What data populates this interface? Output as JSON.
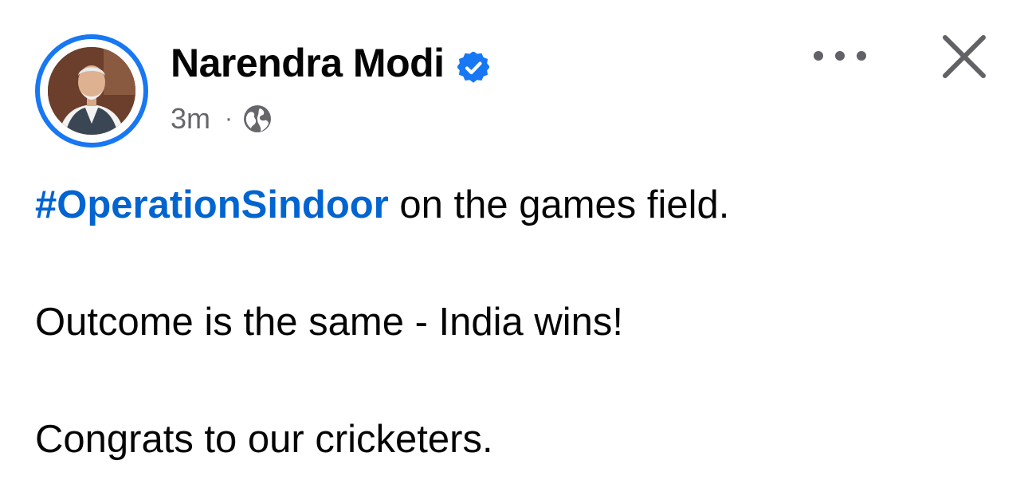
{
  "post": {
    "author": {
      "name": "Narendra Modi",
      "verified": true,
      "avatar_icon": "profile-photo"
    },
    "meta": {
      "time": "3m",
      "separator": "·",
      "audience_icon": "globe-icon"
    },
    "actions": {
      "more_icon": "more-dots-icon",
      "close_icon": "close-icon"
    },
    "body": {
      "hashtag": "#OperationSindoor",
      "line1_rest": " on the games field.",
      "line2": "Outcome is the same - India wins!",
      "line3": "Congrats to our cricketers."
    }
  },
  "colors": {
    "accent": "#1877f2",
    "hashtag": "#0064d1",
    "text": "#050505",
    "secondary_text": "#65676b",
    "icon_gray": "#606266"
  }
}
